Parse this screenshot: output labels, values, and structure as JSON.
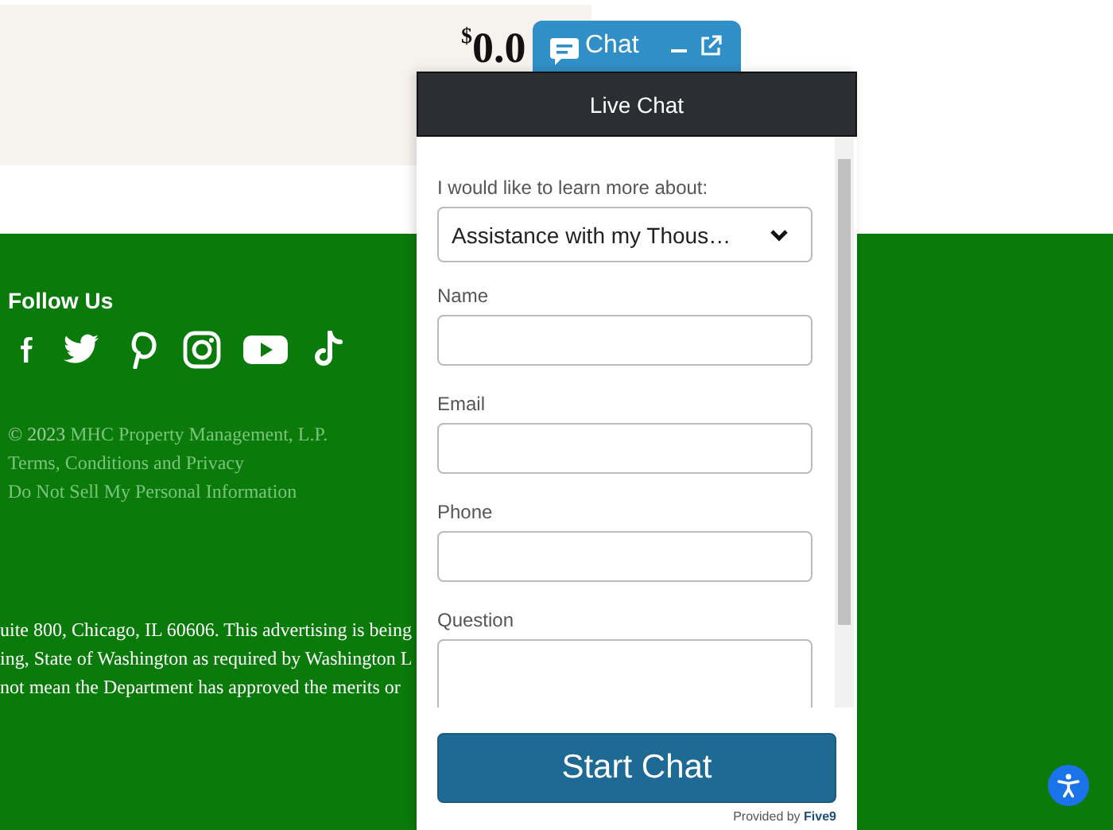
{
  "price": {
    "currency": "$",
    "amount": "0.0"
  },
  "footer": {
    "follow_title": "Follow Us",
    "social": [
      {
        "kind": "facebook"
      },
      {
        "kind": "twitter"
      },
      {
        "kind": "pinterest"
      },
      {
        "kind": "instagram"
      },
      {
        "kind": "youtube"
      },
      {
        "kind": "tiktok"
      }
    ],
    "copyright": "© 2023",
    "company_link": "MHC Property Management, L.P.",
    "links": [
      "Terms, Conditions and Privacy",
      "Do Not Sell My Personal Information"
    ],
    "legal_lines": [
      "uite 800, Chicago, IL 60606. This advertising is being",
      "ing, State of Washington as required by Washington L",
      "not mean the Department has approved the merits or"
    ]
  },
  "chat": {
    "tab_label": "Chat",
    "title": "Live Chat",
    "fields": [
      {
        "kind": "select",
        "label": "I would like to learn more about:",
        "value": "Assistance with my Thous…"
      },
      {
        "kind": "text",
        "label": "Name"
      },
      {
        "kind": "text",
        "label": "Email"
      },
      {
        "kind": "text",
        "label": "Phone"
      },
      {
        "kind": "textarea",
        "label": "Question"
      }
    ],
    "submit": "Start Chat",
    "provided_by": "Provided by **Five9**"
  }
}
